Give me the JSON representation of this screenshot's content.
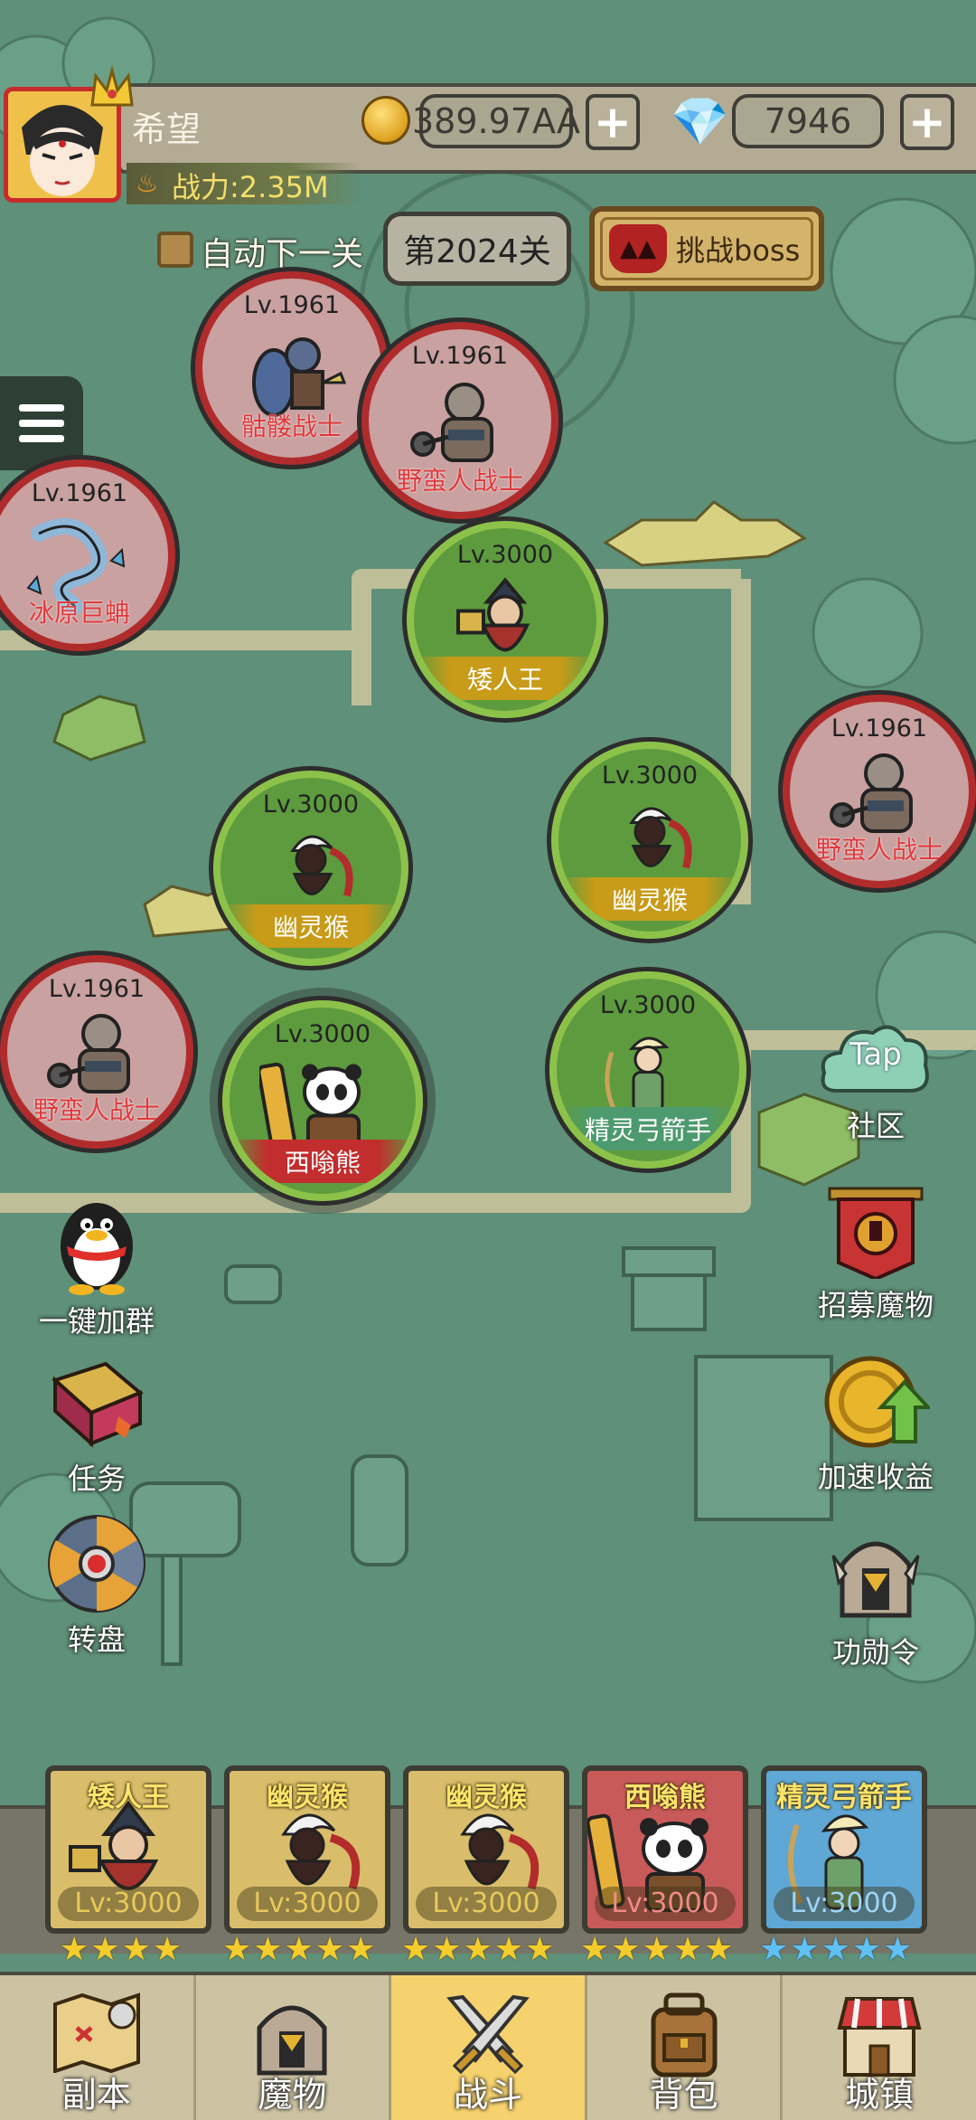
{
  "player": {
    "name": "希望",
    "power": "战力:2.35M"
  },
  "resources": {
    "gold": "389.97AA",
    "gems": "7946",
    "plus": "+"
  },
  "stage": {
    "auto_next_label": "自动下一关",
    "level": "第2024关",
    "boss_label": "挑战boss"
  },
  "enemies": [
    {
      "level": "Lv.1961",
      "name": "骷髅战士"
    },
    {
      "level": "Lv.1961",
      "name": "野蛮人战士"
    },
    {
      "level": "Lv.1961",
      "name": "冰原巨蚺"
    },
    {
      "level": "Lv.1961",
      "name": "野蛮人战士"
    },
    {
      "level": "Lv.1961",
      "name": "野蛮人战士"
    }
  ],
  "allies": [
    {
      "level": "Lv.3000",
      "name": "矮人王"
    },
    {
      "level": "Lv.3000",
      "name": "幽灵猴"
    },
    {
      "level": "Lv.3000",
      "name": "幽灵猴"
    },
    {
      "level": "Lv.3000",
      "name": "精灵弓箭手"
    },
    {
      "level": "Lv.3000",
      "name": "西嗡熊"
    }
  ],
  "side_left": [
    {
      "label": "一键加群",
      "icon": "penguin-icon"
    },
    {
      "label": "任务",
      "icon": "quest-book-icon"
    },
    {
      "label": "转盘",
      "icon": "wheel-icon"
    }
  ],
  "side_right": [
    {
      "label": "社区",
      "icon": "tap-cloud-icon",
      "badge": "Tap"
    },
    {
      "label": "招募魔物",
      "icon": "banner-icon"
    },
    {
      "label": "加速收益",
      "icon": "gold-coin-icon"
    },
    {
      "label": "功勋令",
      "icon": "helmet-icon"
    }
  ],
  "team": [
    {
      "name": "矮人王",
      "level": "Lv:3000",
      "stars": 4,
      "star_color": "gold"
    },
    {
      "name": "幽灵猴",
      "level": "Lv:3000",
      "stars": 5,
      "star_color": "gold"
    },
    {
      "name": "幽灵猴",
      "level": "Lv:3000",
      "stars": 5,
      "star_color": "gold"
    },
    {
      "name": "西嗡熊",
      "level": "Lv:3000",
      "stars": 5,
      "star_color": "gold"
    },
    {
      "name": "精灵弓箭手",
      "level": "Lv:3000",
      "stars": 5,
      "star_color": "blue"
    }
  ],
  "nav": [
    {
      "label": "副本",
      "icon": "map-icon"
    },
    {
      "label": "魔物",
      "icon": "monster-helmet-icon"
    },
    {
      "label": "战斗",
      "icon": "crossed-swords-icon",
      "active": true
    },
    {
      "label": "背包",
      "icon": "backpack-icon"
    },
    {
      "label": "城镇",
      "icon": "shop-icon"
    }
  ]
}
